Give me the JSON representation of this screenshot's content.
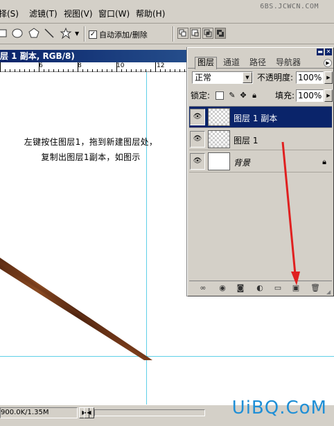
{
  "menu": {
    "items": [
      {
        "label": "选择(S)",
        "mnemonic": "S"
      },
      {
        "label": "滤镜(T)",
        "mnemonic": "T"
      },
      {
        "label": "视图(V)",
        "mnemonic": "V"
      },
      {
        "label": "窗口(W)",
        "mnemonic": "W"
      },
      {
        "label": "帮助(H)",
        "mnemonic": "H"
      }
    ],
    "visible_text": [
      "择(S)",
      "滤镜(T)",
      "视图(V)",
      "窗口(W)",
      "帮助(H)"
    ]
  },
  "watermark_top": "6BS.JCWCN.COM",
  "options": {
    "auto_add_label": "自动添加/删除",
    "auto_add_checked": true,
    "check_glyph": "✓",
    "tools": [
      "rectangle-icon",
      "ellipse-icon",
      "polygon-icon",
      "line-icon",
      "custom-shape-icon"
    ],
    "combine_modes": [
      "add-to-shape-icon",
      "subtract-shape-icon",
      "intersect-shape-icon",
      "exclude-shape-icon"
    ]
  },
  "document": {
    "title": "层 1 副本, RGB/8)",
    "ruler_numbers": [
      "6",
      "8",
      "10",
      "12"
    ],
    "instruction_lines": [
      "左键按住图层1，拖到新建图层处，",
      "复制出图层1副本，如图示"
    ]
  },
  "status": {
    "text": "900.0K/1.35M",
    "arrow_right": "▶",
    "arrow_left": "◀"
  },
  "palette": {
    "tabs": [
      "图层",
      "通道",
      "路径",
      "导航器"
    ],
    "active_tab": "图层",
    "blend_mode": "正常",
    "opacity_label": "不透明度:",
    "opacity_value": "100%",
    "lock_label": "锁定:",
    "fill_label": "填充:",
    "fill_value": "100%",
    "layers": [
      {
        "name": "图层 1 副本",
        "selected": true,
        "visible": true,
        "thumb": "transparent"
      },
      {
        "name": "图层 1",
        "selected": false,
        "visible": true,
        "thumb": "transparent"
      },
      {
        "name": "背景",
        "selected": false,
        "visible": true,
        "thumb": "white",
        "locked": true
      }
    ],
    "bottom_buttons": [
      "link-icon",
      "layer-style-icon",
      "mask-icon",
      "adjustment-layer-icon",
      "folder-icon",
      "new-layer-icon",
      "trash-icon"
    ]
  },
  "colors": {
    "title_blue": "#0a246a",
    "guide": "#5fd0e8",
    "annotation_red": "#e02020",
    "watermark_blue": "#1f8fd6"
  },
  "watermark_bottom": "UiBQ.CoM"
}
